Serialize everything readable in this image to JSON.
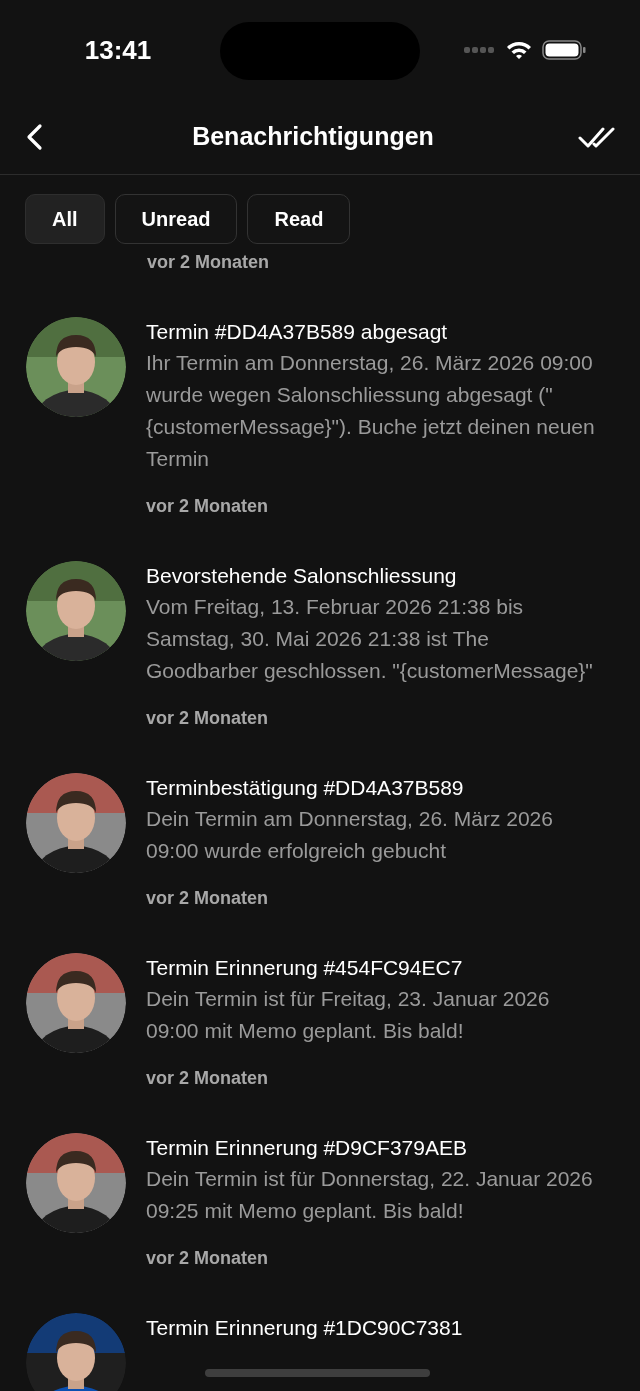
{
  "status_bar": {
    "time": "13:41"
  },
  "header": {
    "title": "Benachrichtigungen"
  },
  "filters": [
    {
      "label": "All",
      "selected": true
    },
    {
      "label": "Unread",
      "selected": false
    },
    {
      "label": "Read",
      "selected": false
    }
  ],
  "partial_item": {
    "time": "vor 2 Monaten"
  },
  "notifications": [
    {
      "title": "Termin #DD4A37B589 abgesagt",
      "body": "Ihr Termin am Donnerstag, 26. März 2026 09:00 wurde wegen Salonschliessung abgesagt (\"{customerMessage}\"). Buche jetzt deinen neuen Termin",
      "time": "vor 2 Monaten"
    },
    {
      "title": "Bevorstehende Salonschliessung",
      "body": "Vom Freitag, 13. Februar 2026 21:38 bis Samstag, 30. Mai 2026 21:38 ist The Goodbarber geschlossen. \"{customerMessage}\"",
      "time": "vor 2 Monaten"
    },
    {
      "title": "Terminbestätigung #DD4A37B589",
      "body": "Dein Termin am Donnerstag, 26. März 2026 09:00 wurde erfolgreich gebucht",
      "time": "vor 2 Monaten"
    },
    {
      "title": "Termin Erinnerung #454FC94EC7",
      "body": "Dein Termin ist für Freitag, 23. Januar 2026 09:00 mit Memo geplant. Bis bald!",
      "time": "vor 2 Monaten"
    },
    {
      "title": "Termin Erinnerung #D9CF379AEB",
      "body": "Dein Termin ist für Donnerstag, 22. Januar 2026 09:25 mit Memo geplant. Bis bald!",
      "time": "vor 2 Monaten"
    },
    {
      "title": "Termin Erinnerung #1DC90C7381"
    }
  ]
}
